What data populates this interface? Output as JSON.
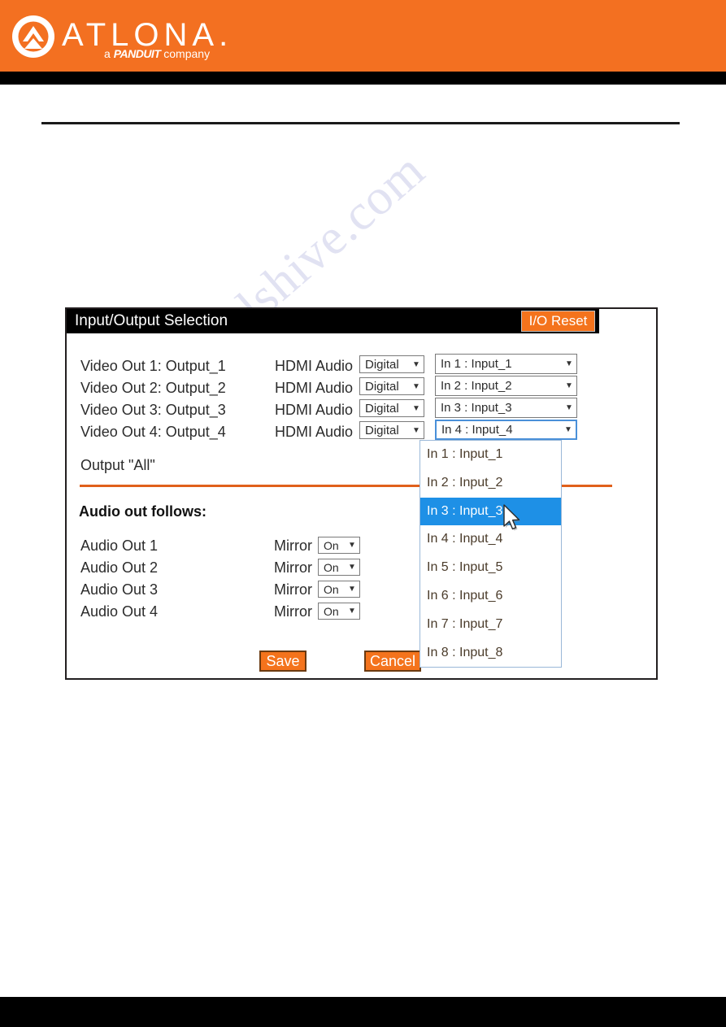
{
  "brand": {
    "wordmark": "ATLONA.",
    "tagline_prefix": "a ",
    "tagline_brand": "PANDUIT",
    "tagline_suffix": " company",
    "logo_icon": "atlona-chevron-logo",
    "header_color": "#f37021"
  },
  "watermark": {
    "text": "manualshive.com"
  },
  "panel": {
    "title": "Input/Output Selection",
    "io_reset_label": "I/O Reset",
    "title_bar_color": "#000000",
    "accent_color": "#f4731c",
    "video_rows": [
      {
        "output_label": "Video Out 1: Output_1",
        "hdmi_audio_label": "HDMI Audio",
        "audio_value": "Digital",
        "input_value": "In 1 : Input_1",
        "active": false
      },
      {
        "output_label": "Video Out 2: Output_2",
        "hdmi_audio_label": "HDMI Audio",
        "audio_value": "Digital",
        "input_value": "In 2 : Input_2",
        "active": false
      },
      {
        "output_label": "Video Out 3: Output_3",
        "hdmi_audio_label": "HDMI Audio",
        "audio_value": "Digital",
        "input_value": "In 3 : Input_3",
        "active": false
      },
      {
        "output_label": "Video Out 4: Output_4",
        "hdmi_audio_label": "HDMI Audio",
        "audio_value": "Digital",
        "input_value": "In 4 : Input_4",
        "active": true
      }
    ],
    "output_all_label": "Output \"All\"",
    "audio_section_title": "Audio out follows:",
    "audio_rows": [
      {
        "label": "Audio Out 1",
        "mirror_label": "Mirror",
        "mirror_value": "On"
      },
      {
        "label": "Audio Out 2",
        "mirror_label": "Mirror",
        "mirror_value": "On"
      },
      {
        "label": "Audio Out 3",
        "mirror_label": "Mirror",
        "mirror_value": "On"
      },
      {
        "label": "Audio Out 4",
        "mirror_label": "Mirror",
        "mirror_value": "On"
      }
    ],
    "save_label": "Save",
    "cancel_label": "Cancel"
  },
  "dropdown": {
    "open": true,
    "selected_index": 2,
    "highlight_color": "#1e90e6",
    "options": [
      "In 1 : Input_1",
      "In 2 : Input_2",
      "In 3 : Input_3",
      "In 4 : Input_4",
      "In 5 : Input_5",
      "In 6 : Input_6",
      "In 7 : Input_7",
      "In 8 : Input_8"
    ]
  },
  "icons": {
    "dropdown_arrow": "▼",
    "cursor": "arrow-cursor"
  }
}
